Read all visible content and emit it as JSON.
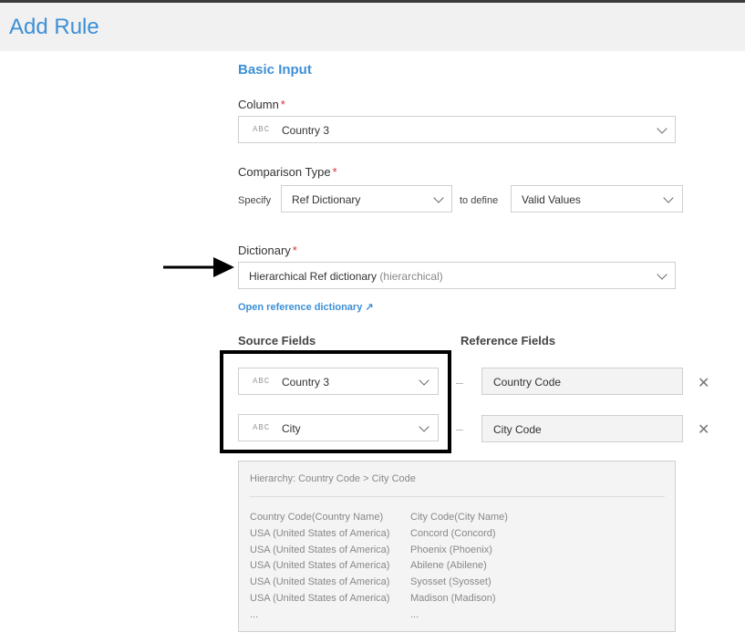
{
  "header": {
    "title": "Add Rule"
  },
  "basic_input": {
    "title": "Basic Input"
  },
  "column": {
    "label": "Column",
    "required_mark": "*",
    "type_badge": "ABC",
    "value": "Country 3"
  },
  "comparison": {
    "label": "Comparison Type",
    "required_mark": "*",
    "specify_label": "Specify",
    "specify_value": "Ref Dictionary",
    "to_define_label": "to define",
    "define_value": "Valid Values"
  },
  "dictionary": {
    "label": "Dictionary",
    "required_mark": "*",
    "value": "Hierarchical Ref dictionary",
    "value_hint": "(hierarchical)",
    "open_link": "Open reference dictionary ↗"
  },
  "fields": {
    "source_header": "Source Fields",
    "reference_header": "Reference Fields",
    "rows": [
      {
        "type_badge": "ABC",
        "source": "Country 3",
        "reference": "Country Code",
        "remove": "✕"
      },
      {
        "type_badge": "ABC",
        "source": "City",
        "reference": "City Code",
        "remove": "✕"
      }
    ]
  },
  "preview": {
    "title": "Hierarchy: Country Code > City Code",
    "col1": [
      "Country Code(Country Name)",
      "USA (United States of America)",
      "USA (United States of America)",
      "USA (United States of America)",
      "USA (United States of America)",
      "USA (United States of America)",
      "..."
    ],
    "col2": [
      "City Code(City Name)",
      "Concord (Concord)",
      "Phoenix (Phoenix)",
      "Abilene (Abilene)",
      "Syosset (Syosset)",
      "Madison (Madison)",
      "..."
    ]
  },
  "annotations": {
    "arrow_icon": "right-arrow-icon",
    "highlight_color": "#000000"
  },
  "colors": {
    "accent": "#3d8fd6",
    "required": "#e03030"
  }
}
